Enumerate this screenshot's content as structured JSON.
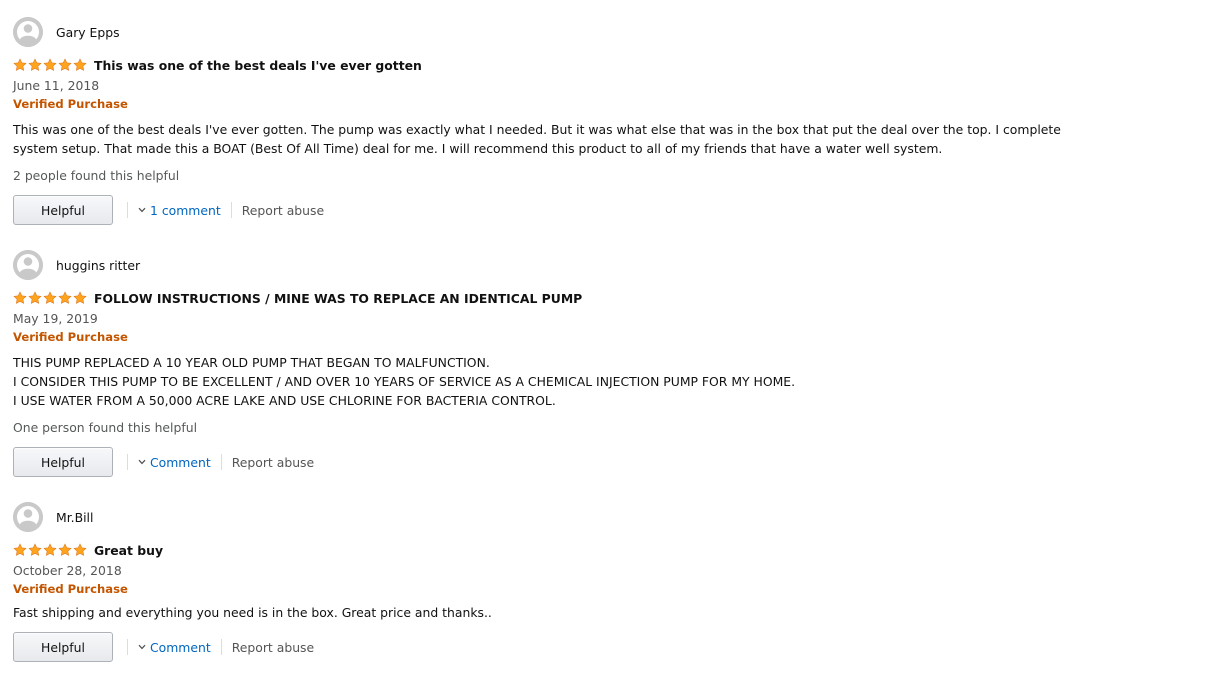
{
  "colors": {
    "star": "#ffa41c",
    "verified": "#c45500",
    "link": "#0066c0",
    "muted": "#565959"
  },
  "reviews": [
    {
      "profile_name": "Gary Epps",
      "rating": 5,
      "title": "This was one of the best deals I've ever gotten",
      "date": "June 11, 2018",
      "verified": "Verified Purchase",
      "body": [
        "This was one of the best deals I've ever gotten. The pump was exactly what I needed. But it was what else that was in the box that put the deal over the top. I complete system setup. That made this a BOAT (Best Of All Time) deal for me. I will recommend this product to all of my friends that have a water well system."
      ],
      "helpful_count": "2 people found this helpful",
      "helpful_label": "Helpful",
      "comment_label": "1 comment",
      "report_label": "Report abuse"
    },
    {
      "profile_name": "huggins ritter",
      "rating": 5,
      "title": "FOLLOW INSTRUCTIONS / MINE WAS TO REPLACE AN IDENTICAL PUMP",
      "date": "May 19, 2019",
      "verified": "Verified Purchase",
      "body": [
        "THIS PUMP REPLACED A 10 YEAR OLD PUMP THAT BEGAN TO MALFUNCTION.",
        "I CONSIDER THIS PUMP TO BE EXCELLENT / AND OVER 10 YEARS OF SERVICE AS A CHEMICAL INJECTION PUMP FOR MY HOME.",
        "I USE WATER FROM A 50,000 ACRE LAKE AND USE CHLORINE FOR BACTERIA CONTROL."
      ],
      "helpful_count": "One person found this helpful",
      "helpful_label": "Helpful",
      "comment_label": "Comment",
      "report_label": "Report abuse"
    },
    {
      "profile_name": "Mr.Bill",
      "rating": 5,
      "title": "Great buy",
      "date": "October 28, 2018",
      "verified": "Verified Purchase",
      "body": [
        "Fast shipping and everything you need is in the box. Great price and thanks.."
      ],
      "helpful_label": "Helpful",
      "comment_label": "Comment",
      "report_label": "Report abuse"
    }
  ]
}
